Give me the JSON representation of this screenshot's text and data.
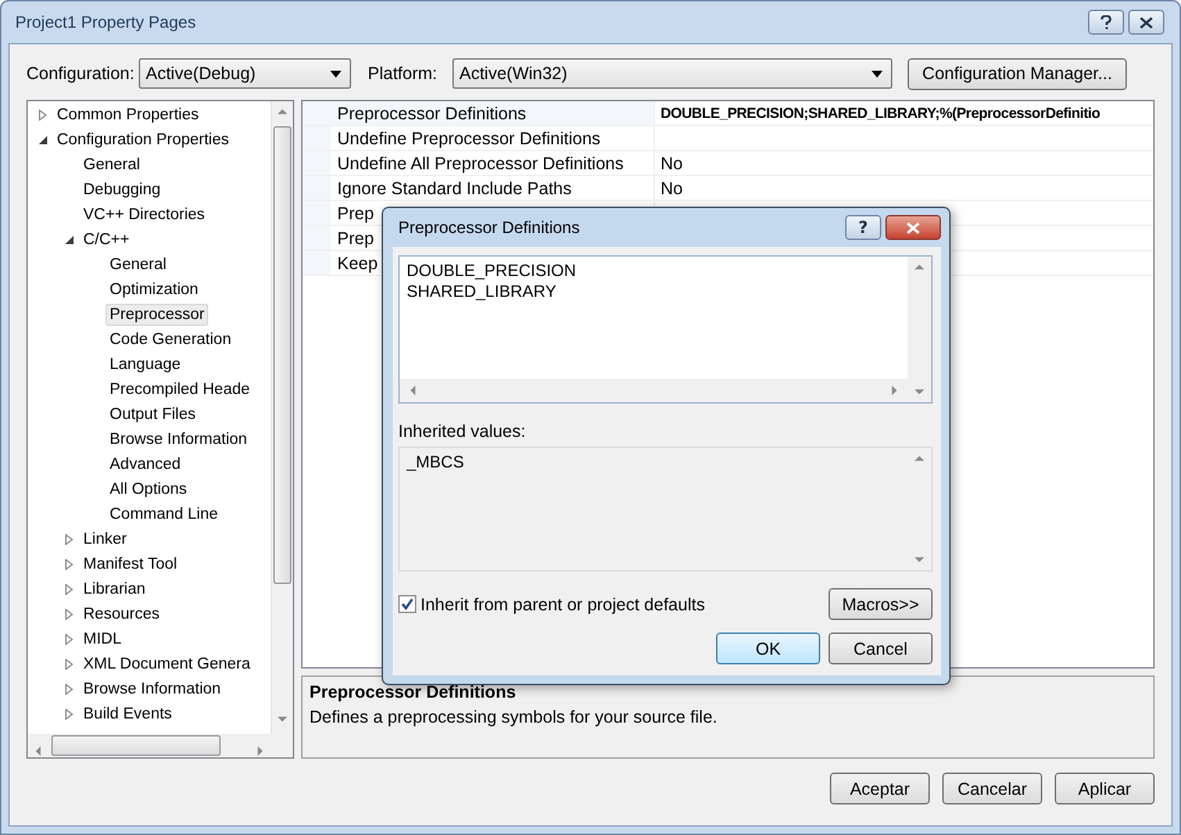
{
  "window": {
    "title": "Project1 Property Pages"
  },
  "toolbar": {
    "configuration_label": "Configuration:",
    "configuration": "Active(Debug)",
    "platform_label": "Platform:",
    "platform": "Active(Win32)",
    "manager_button": "Configuration Manager..."
  },
  "tree": [
    {
      "label": "Common Properties",
      "expanded": false,
      "selected": false
    },
    {
      "label": "Configuration Properties",
      "expanded": true,
      "selected": false,
      "children": [
        {
          "label": "General",
          "selected": false
        },
        {
          "label": "Debugging",
          "selected": false
        },
        {
          "label": "VC++ Directories",
          "selected": false
        },
        {
          "label": "C/C++",
          "expanded": true,
          "selected": false,
          "children": [
            {
              "label": "General",
              "selected": false
            },
            {
              "label": "Optimization",
              "selected": false
            },
            {
              "label": "Preprocessor",
              "selected": true
            },
            {
              "label": "Code Generation",
              "selected": false
            },
            {
              "label": "Language",
              "selected": false
            },
            {
              "label": "Precompiled Heade",
              "selected": false
            },
            {
              "label": "Output Files",
              "selected": false
            },
            {
              "label": "Browse Information",
              "selected": false
            },
            {
              "label": "Advanced",
              "selected": false
            },
            {
              "label": "All Options",
              "selected": false
            },
            {
              "label": "Command Line",
              "selected": false
            }
          ]
        },
        {
          "label": "Linker",
          "expanded": false,
          "selected": false
        },
        {
          "label": "Manifest Tool",
          "expanded": false,
          "selected": false
        },
        {
          "label": "Librarian",
          "expanded": false,
          "selected": false
        },
        {
          "label": "Resources",
          "expanded": false,
          "selected": false
        },
        {
          "label": "MIDL",
          "expanded": false,
          "selected": false
        },
        {
          "label": "XML Document Genera",
          "expanded": false,
          "selected": false
        },
        {
          "label": "Browse Information",
          "expanded": false,
          "selected": false
        },
        {
          "label": "Build Events",
          "expanded": false,
          "selected": false
        }
      ]
    }
  ],
  "properties": [
    {
      "name": "Preprocessor Definitions",
      "value": "DOUBLE_PRECISION;SHARED_LIBRARY;%(PreprocessorDefinitio",
      "selected": true
    },
    {
      "name": "Undefine Preprocessor Definitions",
      "selected": false
    },
    {
      "name": "Undefine All Preprocessor Definitions",
      "value": "No",
      "selected": false
    },
    {
      "name": "Ignore Standard Include Paths",
      "value": "No",
      "selected": false
    },
    {
      "name": "Prep",
      "selected": false
    },
    {
      "name": "Prep",
      "selected": false
    },
    {
      "name": "Keep",
      "selected": false
    }
  ],
  "description": {
    "title": "Preprocessor Definitions",
    "text": "Defines a preprocessing symbols for your source file."
  },
  "buttons": [
    "Aceptar",
    "Cancelar",
    "Aplicar"
  ],
  "dialog": {
    "title": "Preprocessor Definitions",
    "help": "?",
    "definitions": [
      "DOUBLE_PRECISION",
      "SHARED_LIBRARY"
    ],
    "inherited_label": "Inherited values:",
    "inherited": [
      "_MBCS"
    ],
    "inherit_checkbox": {
      "label": "Inherit from parent or project defaults",
      "checked": true
    },
    "macros_button": "Macros>>",
    "ok_button": "OK",
    "cancel_button": "Cancel"
  }
}
